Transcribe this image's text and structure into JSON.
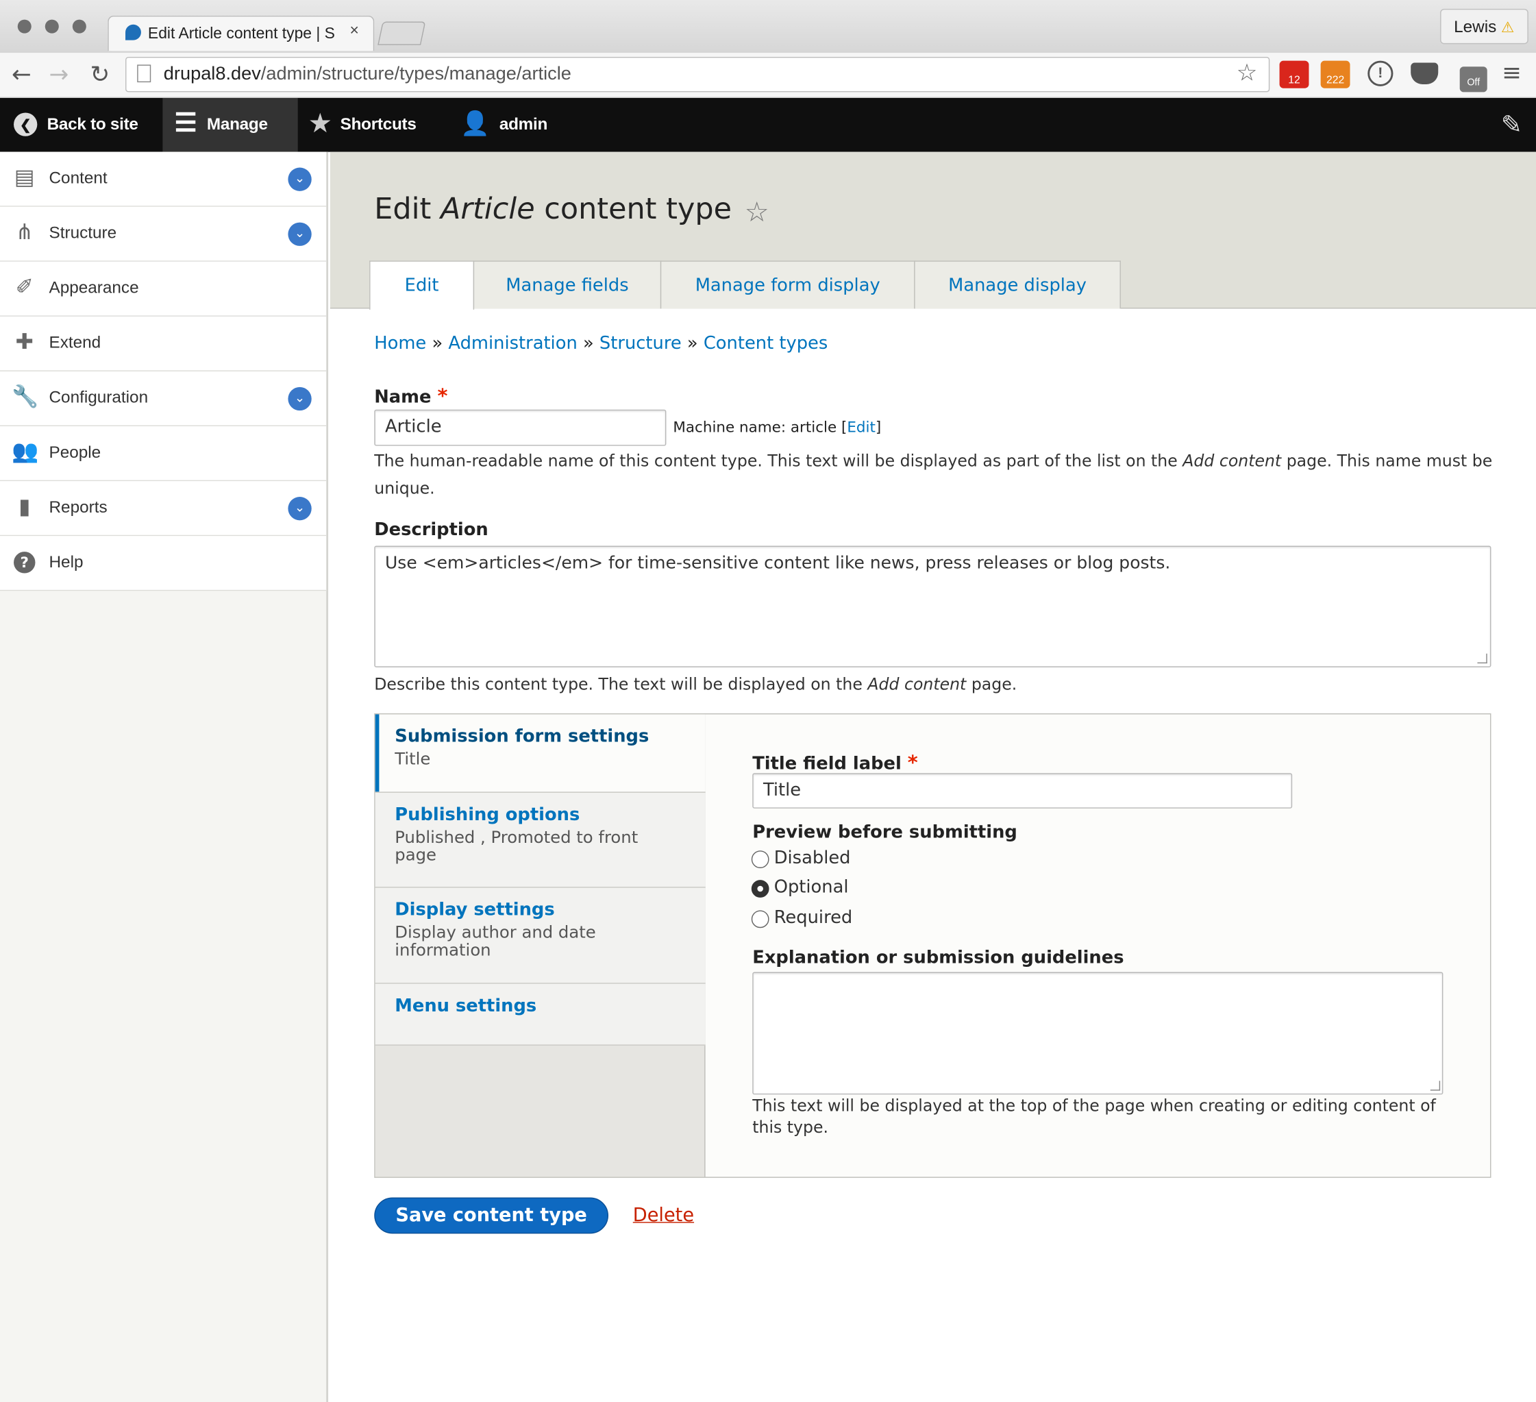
{
  "browser": {
    "tab_title": "Edit Article content type | S",
    "tab_close": "×",
    "profile_name": "Lewis",
    "url_host": "drupal8.dev",
    "url_path": "/admin/structure/types/manage/article",
    "ext_badge_1": "12",
    "ext_badge_2": "222",
    "ext_badge_3": "Off"
  },
  "toolbar": {
    "back_label": "Back to site",
    "manage_label": "Manage",
    "shortcuts_label": "Shortcuts",
    "user_label": "admin"
  },
  "sidebar": {
    "items": [
      {
        "label": "Content",
        "icon": "document-icon",
        "expandable": true
      },
      {
        "label": "Structure",
        "icon": "sitemap-icon",
        "expandable": true
      },
      {
        "label": "Appearance",
        "icon": "paintbrush-icon",
        "expandable": false
      },
      {
        "label": "Extend",
        "icon": "puzzle-icon",
        "expandable": false
      },
      {
        "label": "Configuration",
        "icon": "wrench-icon",
        "expandable": true
      },
      {
        "label": "People",
        "icon": "people-icon",
        "expandable": false
      },
      {
        "label": "Reports",
        "icon": "bar-chart-icon",
        "expandable": true
      },
      {
        "label": "Help",
        "icon": "help-icon",
        "expandable": false
      }
    ]
  },
  "page": {
    "title_prefix": "Edit ",
    "title_em": "Article",
    "title_suffix": " content type",
    "tabs": [
      "Edit",
      "Manage fields",
      "Manage form display",
      "Manage display"
    ],
    "breadcrumb": [
      "Home",
      "Administration",
      "Structure",
      "Content types"
    ],
    "breadcrumb_sep": "»"
  },
  "form": {
    "name_label": "Name",
    "required_mark": "*",
    "name_value": "Article",
    "machine_name_prefix": "Machine name: article [",
    "machine_name_edit": "Edit",
    "machine_name_suffix": "]",
    "name_help_1": "The human-readable name of this content type. This text will be displayed as part of the list on the ",
    "name_help_em": "Add content",
    "name_help_2": " page. This name must be unique.",
    "description_label": "Description",
    "description_value": "Use <em>articles</em> for time-sensitive content like news, press releases or blog posts.",
    "description_help_1": "Describe this content type. The text will be displayed on the ",
    "description_help_em": "Add content",
    "description_help_2": " page."
  },
  "vertical_tabs": [
    {
      "title": "Submission form settings",
      "summary": "Title"
    },
    {
      "title": "Publishing options",
      "summary": "Published , Promoted to front page"
    },
    {
      "title": "Display settings",
      "summary": "Display author and date information"
    },
    {
      "title": "Menu settings",
      "summary": ""
    }
  ],
  "submission": {
    "title_field_label": "Title field label",
    "title_field_value": "Title",
    "preview_label": "Preview before submitting",
    "preview_options": [
      "Disabled",
      "Optional",
      "Required"
    ],
    "preview_selected": "Optional",
    "guidelines_label": "Explanation or submission guidelines",
    "guidelines_value": "",
    "guidelines_help": "This text will be displayed at the top of the page when creating or editing content of this type."
  },
  "actions": {
    "save_label": "Save content type",
    "delete_label": "Delete"
  },
  "colors": {
    "link": "#0074bd",
    "primary_button": "#0e69c1",
    "danger": "#c72100",
    "toolbar_bg": "#0f0f0f"
  }
}
